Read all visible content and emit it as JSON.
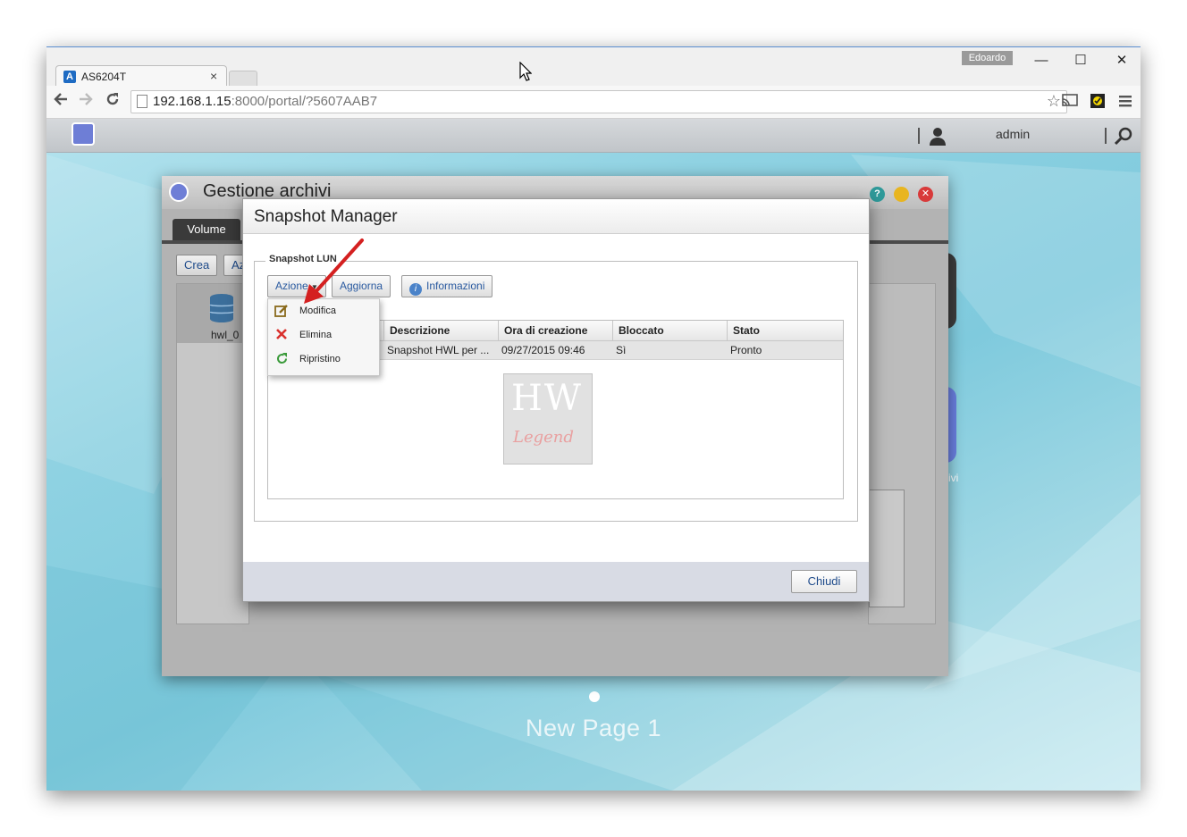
{
  "browser": {
    "tab_title": "AS6204T",
    "tab_close": "×",
    "user_badge": "Edoardo",
    "window_controls": {
      "minimize": "—",
      "maximize": "☐",
      "close": "✕"
    },
    "url_host": "192.168.1.15",
    "url_rest": ":8000/portal/?5607AAB7",
    "icons": [
      "back-icon",
      "forward-icon",
      "reload-icon",
      "bookmark-star-icon",
      "cast-icon",
      "extension-icon",
      "menu-icon"
    ]
  },
  "adm": {
    "username": "admin",
    "page_label": "New Page 1",
    "hidden_label_fragment": "ivi"
  },
  "gestione": {
    "title": "Gestione archivi",
    "tabs": [
      "Volume",
      "",
      "",
      ""
    ],
    "buttons": {
      "crea": "Crea",
      "az": "Az"
    },
    "volume_label": "hwl_0"
  },
  "snapshot": {
    "title": "Snapshot Manager",
    "group_label": "Snapshot LUN",
    "buttons": {
      "azione": "Azione",
      "aggiorna": "Aggiorna",
      "informazioni": "Informazioni"
    },
    "menu": [
      {
        "label": "Modifica",
        "icon": "edit-icon",
        "color": "#8a6a1c"
      },
      {
        "label": "Elimina",
        "icon": "delete-x-icon",
        "color": "#d9302c"
      },
      {
        "label": "Ripristino",
        "icon": "restore-icon",
        "color": "#3a9a3a"
      }
    ],
    "columns": [
      "",
      "Descrizione",
      "Ora di creazione",
      "Bloccato",
      "Stato"
    ],
    "rows": [
      {
        "name": "",
        "descrizione": "Snapshot HWL per ...",
        "ora": "09/27/2015 09:46",
        "bloccato": "Sì",
        "stato": "Pronto"
      }
    ],
    "close_button": "Chiudi"
  },
  "watermark": {
    "text_top": "HW",
    "text_bottom": "Legend"
  },
  "colors": {
    "accent": "#1d4a8a",
    "arrow": "#d42020",
    "desktop": "#8fd2e2"
  }
}
